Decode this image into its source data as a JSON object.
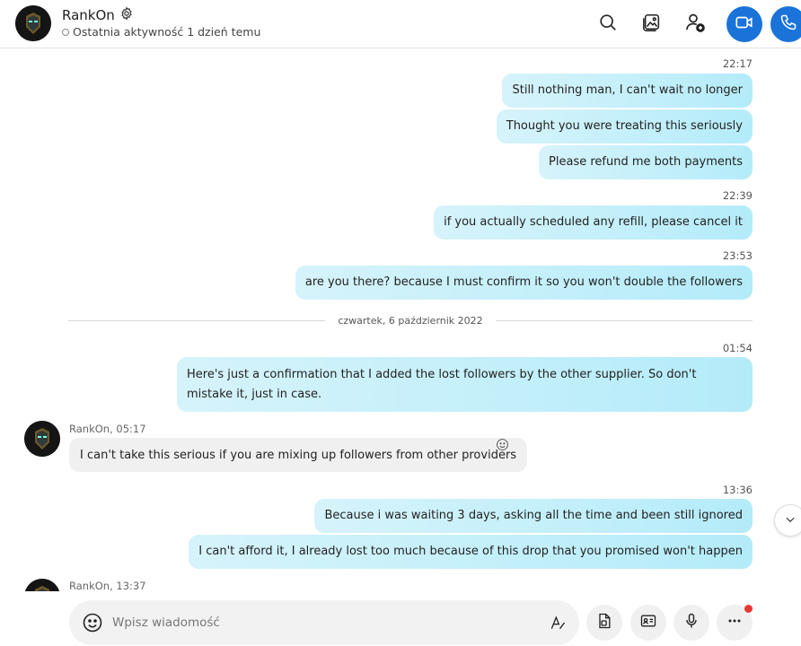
{
  "header": {
    "contact_name": "RankOn",
    "status_text": "Ostatnia aktywność 1 dzień temu",
    "icons": [
      "gear-icon",
      "search-icon",
      "gallery-icon",
      "add-person-icon",
      "video-call-icon",
      "phone-icon"
    ],
    "accent_color": "#1a73d9"
  },
  "chat": {
    "outgoing": [
      {
        "time": "22:17",
        "messages": [
          "Still nothing man, I can't wait no longer",
          "Thought you were treating this seriously",
          "Please refund me both payments"
        ]
      },
      {
        "time": "22:39",
        "messages": [
          "if you actually scheduled any refill, please cancel it"
        ]
      },
      {
        "time": "23:53",
        "messages": [
          "are you there? because I must confirm it so you won't double the followers"
        ]
      }
    ],
    "date_divider": "czwartek, 6 październik 2022",
    "outgoing_2": {
      "time": "01:54",
      "message": "Here's just a confirmation that I added the lost followers by the other supplier. So don't mistake it, just in case."
    },
    "incoming_1": {
      "sender": "RankOn, 05:17",
      "message": "I can't take this serious if you are mixing up followers from other providers"
    },
    "outgoing_3": {
      "time": "13:36",
      "messages": [
        "Because i was waiting 3 days, asking all the time and been still ignored",
        "I can't afford it, I already lost too much because of this drop that you promised won't happen"
      ]
    },
    "incoming_2": {
      "sender": "RankOn, 13:37"
    }
  },
  "composer": {
    "placeholder": "Wpisz wiadomość"
  }
}
